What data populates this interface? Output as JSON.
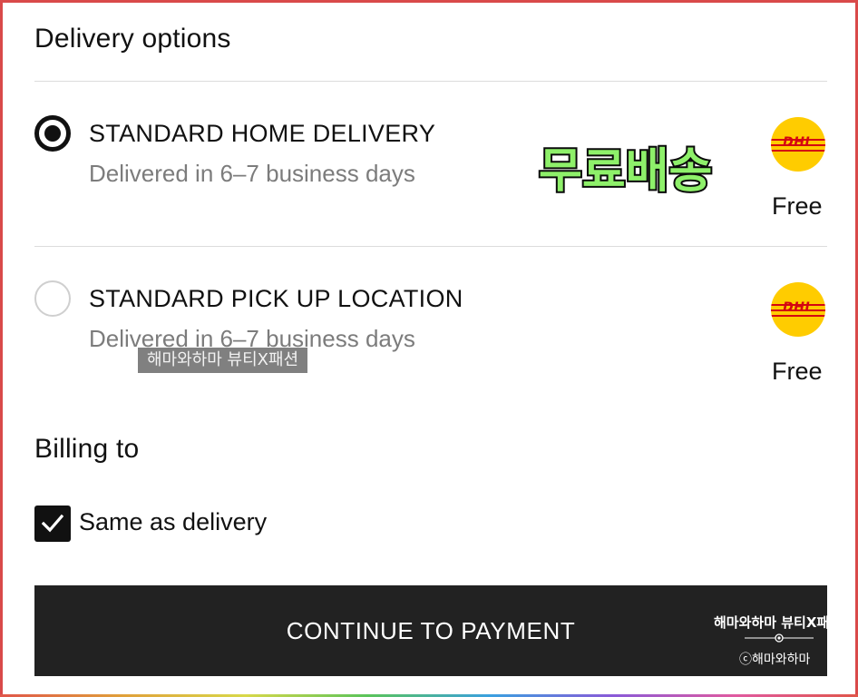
{
  "delivery": {
    "heading": "Delivery options",
    "options": [
      {
        "title": "STANDARD HOME DELIVERY",
        "subtitle": "Delivered in 6–7 business days",
        "price": "Free",
        "carrier_logo": "DHL",
        "selected": true
      },
      {
        "title": "STANDARD PICK UP LOCATION",
        "subtitle": "Delivered in 6–7 business days",
        "price": "Free",
        "carrier_logo": "DHL",
        "selected": false
      }
    ]
  },
  "overlay": {
    "promo_text": "무료배송",
    "watermark_tag": "해마와하마 뷰티X패션"
  },
  "billing": {
    "heading": "Billing to",
    "same_as_delivery_label": "Same as delivery",
    "same_as_delivery_checked": true
  },
  "cta": {
    "label": "CONTINUE TO PAYMENT",
    "watermark_line1": "해마와하마 뷰티X패",
    "watermark_line2": "ⓒ해마와하마"
  },
  "colors": {
    "accent_dark": "#111111",
    "button_bg": "#222222",
    "dhl_yellow": "#ffcc00",
    "dhl_red": "#d40511",
    "muted_text": "#7c7c7c",
    "promo_green": "#8ef06a"
  },
  "icons": {
    "radio_selected": "radio-selected-icon",
    "radio_unselected": "radio-unselected-icon",
    "checkbox": "checkmark-icon",
    "carrier": "dhl-logo"
  }
}
